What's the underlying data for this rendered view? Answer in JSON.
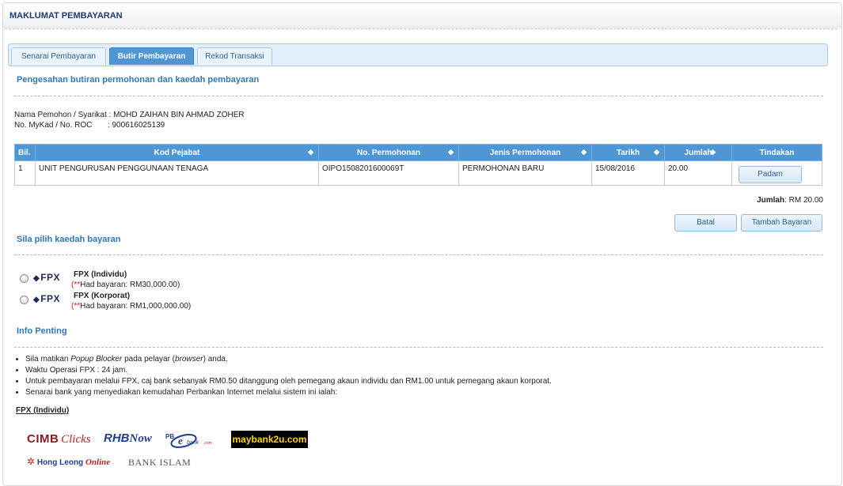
{
  "header": {
    "title": "MAKLUMAT PEMBAYARAN"
  },
  "tabs": [
    {
      "label": "Senarai Pembayaran",
      "active": false
    },
    {
      "label": "Butir Pembayaran",
      "active": true
    },
    {
      "label": "Rekod Transaksi",
      "active": false
    }
  ],
  "confirm": {
    "title": "Pengesahan butiran permohonan dan kaedah pembayaran",
    "applicant_label": "Nama Pemohon / Syarikat :",
    "applicant_value": "MOHD ZAIHAN BIN AHMAD ZOHER",
    "mykad_label": "No. MyKad / No. ROC",
    "mykad_value": ": 900616025139"
  },
  "table": {
    "headers": [
      "Bil.",
      "Kod Pejabat",
      "No. Permohonan",
      "Jenis Permohonan",
      "Tarikh",
      "Jumlah",
      "Tindakan"
    ],
    "rows": [
      {
        "bil": "1",
        "kod_pejabat": "UNIT PENGURUSAN PENGGUNAAN TENAGA",
        "no_permohonan": "OIPO1508201600069T",
        "jenis": "PERMOHONAN BARU",
        "tarikh": "15/08/2016",
        "jumlah": "20.00",
        "action": "Padam"
      }
    ],
    "total_label": "Jumlah",
    "total_value": ": RM 20.00"
  },
  "actions": {
    "cancel": "Batal",
    "add": "Tambah Bayaran"
  },
  "payment": {
    "title": "Sila pilih kaedah bayaran",
    "options": [
      {
        "logo": "FPX",
        "name": "FPX (Individu)",
        "note_prefix": "(**",
        "note": "Had bayaran: RM30,000.00)"
      },
      {
        "logo": "FPX",
        "name": "FPX (Korporat)",
        "note_prefix": "(**",
        "note": "Had bayaran: RM1,000,000.00)"
      }
    ]
  },
  "info": {
    "title": "Info Penting",
    "notes": [
      {
        "pre": "Sila matikan ",
        "em1": "Popup Blocker",
        "mid": " pada pelayar (",
        "em2": "browser",
        "post": ") anda."
      },
      {
        "pre": "Waktu Operasi FPX : 24 jam.",
        "em1": "",
        "mid": "",
        "em2": "",
        "post": ""
      },
      {
        "pre": "Untuk pembayaran melalui FPX, caj bank sebanyak RM0.50 ditanggung oleh pemegang akaun individu dan RM1.00 untuk pemegang akaun korporat.",
        "em1": "",
        "mid": "",
        "em2": "",
        "post": ""
      },
      {
        "pre": "Senarai bank yang menyediakan kemudahan Perbankan Internet melalui sistem ini ialah:",
        "em1": "",
        "mid": "",
        "em2": "",
        "post": ""
      }
    ],
    "fpx_individu_heading": "FPX (Individu)"
  },
  "banks": {
    "cimb": "CIMB Clicks",
    "cimb_a": "CIMB",
    "cimb_b": "Clicks",
    "rhb": "RHBNow",
    "rhb_a": "RHB",
    "rhb_b": "Now",
    "pb": "PBebank.com",
    "maybank": "maybank2u.com",
    "hongleong": "Hong Leong Online",
    "hl_a": "Hong Leong",
    "hl_b": "Online",
    "bankislam": "BANK ISLAM"
  },
  "colors": {
    "accent": "#4e96d4",
    "title": "#2e77b8",
    "header_text": "#1f3a6b"
  }
}
